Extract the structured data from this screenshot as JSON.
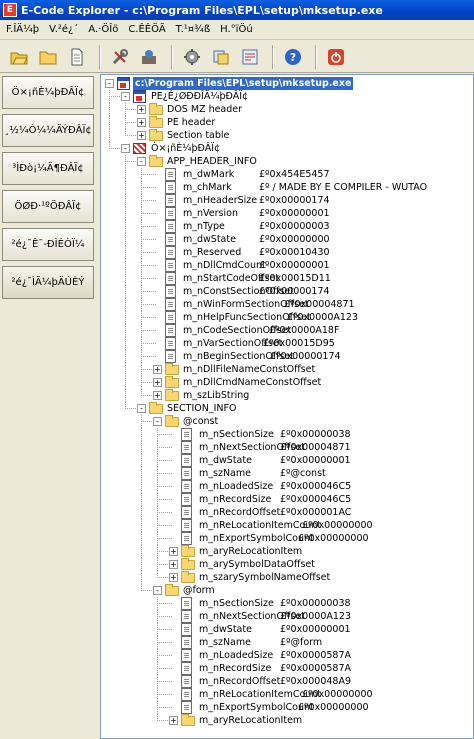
{
  "window": {
    "title": "E-Code Explorer - c:\\Program Files\\EPL\\setup\\mksetup.exe",
    "icon_text": "E"
  },
  "menu": [
    "F.ÎÄ¼þ",
    "V.²é¿´",
    "A.·ÖÎö",
    "C.ÊÊÖÃ",
    "T.¹¤¾ß",
    "H.°ïÖú"
  ],
  "toolbar": [
    {
      "name": "open-icon"
    },
    {
      "name": "open-folder-icon"
    },
    {
      "name": "document-icon"
    },
    {
      "name": "tools-icon"
    },
    {
      "name": "disassemble-icon"
    },
    {
      "name": "settings-icon"
    },
    {
      "name": "copy-icon"
    },
    {
      "name": "options-icon"
    },
    {
      "name": "help-icon"
    },
    {
      "name": "exit-icon"
    }
  ],
  "side_buttons": [
    "Ö×¡ñÈ¼þÐÂÏ¢",
    "¸½¼Ó¼¼ÄÝÐÂÏ¢",
    "³ÌÐò¡¼Ä¶ÐÂÏ¢",
    "ÖØÐ·¹ºÖÐÂÏ¢",
    "²é¿¯Ê¯-ÐÌÉÒÏ¼",
    "²é¿¯ÌÃ¼þÄÚÈÝ"
  ],
  "tree": [
    {
      "level": 0,
      "expand": "-",
      "icon": "app",
      "label": "c:\\Program Files\\EPL\\setup\\mksetup.exe",
      "selected": true
    },
    {
      "level": 1,
      "expand": "-",
      "icon": "app",
      "label": "PE¿É¿ØÐÐÎÄ¼þÐÂÏ¢"
    },
    {
      "level": 2,
      "expand": "+",
      "icon": "folder",
      "label": "DOS MZ header"
    },
    {
      "level": 2,
      "expand": "+",
      "icon": "folder",
      "label": "PE header"
    },
    {
      "level": 2,
      "expand": "+",
      "icon": "folder",
      "label": "Section table"
    },
    {
      "level": 1,
      "expand": "-",
      "icon": "striped",
      "label": "Ò×¡ñÈ¼þÐÂÏ¢"
    },
    {
      "level": 2,
      "expand": "-",
      "icon": "folder",
      "label": "APP_HEADER_INFO"
    },
    {
      "level": 3,
      "icon": "doc",
      "label": "m_dwMark",
      "value": "£º0x454E5457",
      "vx": 258
    },
    {
      "level": 3,
      "icon": "doc",
      "label": "m_chMark",
      "value": "£º / MADE BY E COMPILER - WUTAO",
      "vx": 258
    },
    {
      "level": 3,
      "icon": "doc",
      "label": "m_nHeaderSize",
      "value": "£º0x00000174",
      "vx": 258
    },
    {
      "level": 3,
      "icon": "doc",
      "label": "m_nVersion",
      "value": "£º0x00000001",
      "vx": 258
    },
    {
      "level": 3,
      "icon": "doc",
      "label": "m_nType",
      "value": "£º0x00000003",
      "vx": 258
    },
    {
      "level": 3,
      "icon": "doc",
      "label": "m_dwState",
      "value": "£º0x00000000",
      "vx": 258
    },
    {
      "level": 3,
      "icon": "doc",
      "label": "m_Reserved",
      "value": "£º0x00010430",
      "vx": 258
    },
    {
      "level": 3,
      "icon": "doc",
      "label": "m_nDllCmdCount",
      "value": "£º0x00000001",
      "vx": 258
    },
    {
      "level": 3,
      "icon": "doc",
      "label": "m_nStartCodeOffset",
      "value": "£º0x00015D11",
      "vx": 258
    },
    {
      "level": 3,
      "icon": "doc",
      "label": "m_nConstSectionOffset",
      "value": "£º0x00000174",
      "vx": 258
    },
    {
      "level": 3,
      "icon": "doc",
      "label": "m_nWinFormSectionOffset",
      "value": "£º0x00004871",
      "vx": 283
    },
    {
      "level": 3,
      "icon": "doc",
      "label": "m_nHelpFuncSectionOffset",
      "value": "£º0x0000A123",
      "vx": 286
    },
    {
      "level": 3,
      "icon": "doc",
      "label": "m_nCodeSectionOffset",
      "value": "£º0x0000A18F",
      "vx": 268
    },
    {
      "level": 3,
      "icon": "doc",
      "label": "m_nVarSectionOffset",
      "value": "£º0x00015D95",
      "vx": 262
    },
    {
      "level": 3,
      "icon": "doc",
      "label": "m_nBeginSectionOffset",
      "value": "£º0x00000174",
      "vx": 269
    },
    {
      "level": 3,
      "expand": "+",
      "icon": "folder",
      "label": "m_nDllFileNameConstOffset"
    },
    {
      "level": 3,
      "expand": "+",
      "icon": "folder",
      "label": "m_nDllCmdNameConstOffset"
    },
    {
      "level": 3,
      "expand": "+",
      "icon": "folder",
      "label": "m_szLibString"
    },
    {
      "level": 2,
      "expand": "-",
      "icon": "folder",
      "label": "SECTION_INFO"
    },
    {
      "level": 3,
      "expand": "-",
      "icon": "folder",
      "label": "@const"
    },
    {
      "level": 4,
      "icon": "doc",
      "label": "m_nSectionSize",
      "value": "£º0x00000038",
      "vx": 279
    },
    {
      "level": 4,
      "icon": "doc",
      "label": "m_nNextSectionOffset",
      "value": "£º0x00004871",
      "vx": 279
    },
    {
      "level": 4,
      "icon": "doc",
      "label": "m_dwState",
      "value": "£º0x00000001",
      "vx": 279
    },
    {
      "level": 4,
      "icon": "doc",
      "label": "m_szName",
      "value": "£º@const",
      "vx": 279
    },
    {
      "level": 4,
      "icon": "doc",
      "label": "m_nLoadedSize",
      "value": "£º0x000046C5",
      "vx": 279
    },
    {
      "level": 4,
      "icon": "doc",
      "label": "m_nRecordSize",
      "value": "£º0x000046C5",
      "vx": 279
    },
    {
      "level": 4,
      "icon": "doc",
      "label": "m_nRecordOffset",
      "value": "£º0x000001AC",
      "vx": 279
    },
    {
      "level": 4,
      "icon": "doc",
      "label": "m_nReLocationItemCount",
      "value": "£º0x00000000",
      "vx": 301
    },
    {
      "level": 4,
      "icon": "doc",
      "label": "m_nExportSymbolCount",
      "value": "£º0x00000000",
      "vx": 297
    },
    {
      "level": 4,
      "expand": "+",
      "icon": "folder",
      "label": "m_aryReLocationItem"
    },
    {
      "level": 4,
      "expand": "+",
      "icon": "folder",
      "label": "m_arySymbolDataOffset"
    },
    {
      "level": 4,
      "expand": "+",
      "icon": "folder",
      "label": "m_szarySymbolNameOffset"
    },
    {
      "level": 3,
      "expand": "-",
      "icon": "folder",
      "label": "@form"
    },
    {
      "level": 4,
      "icon": "doc",
      "label": "m_nSectionSize",
      "value": "£º0x00000038",
      "vx": 279
    },
    {
      "level": 4,
      "icon": "doc",
      "label": "m_nNextSectionOffset",
      "value": "£º0x0000A123",
      "vx": 279
    },
    {
      "level": 4,
      "icon": "doc",
      "label": "m_dwState",
      "value": "£º0x00000001",
      "vx": 279
    },
    {
      "level": 4,
      "icon": "doc",
      "label": "m_szName",
      "value": "£º@form",
      "vx": 279
    },
    {
      "level": 4,
      "icon": "doc",
      "label": "m_nLoadedSize",
      "value": "£º0x0000587A",
      "vx": 279
    },
    {
      "level": 4,
      "icon": "doc",
      "label": "m_nRecordSize",
      "value": "£º0x0000587A",
      "vx": 279
    },
    {
      "level": 4,
      "icon": "doc",
      "label": "m_nRecordOffset",
      "value": "£º0x000048A9",
      "vx": 279
    },
    {
      "level": 4,
      "icon": "doc",
      "label": "m_nReLocationItemCount",
      "value": "£º0x00000000",
      "vx": 301
    },
    {
      "level": 4,
      "icon": "doc",
      "label": "m_nExportSymbolCount",
      "value": "£º0x00000000",
      "vx": 297
    },
    {
      "level": 4,
      "expand": "+",
      "icon": "folder",
      "label": "m_aryReLocationItem"
    }
  ]
}
